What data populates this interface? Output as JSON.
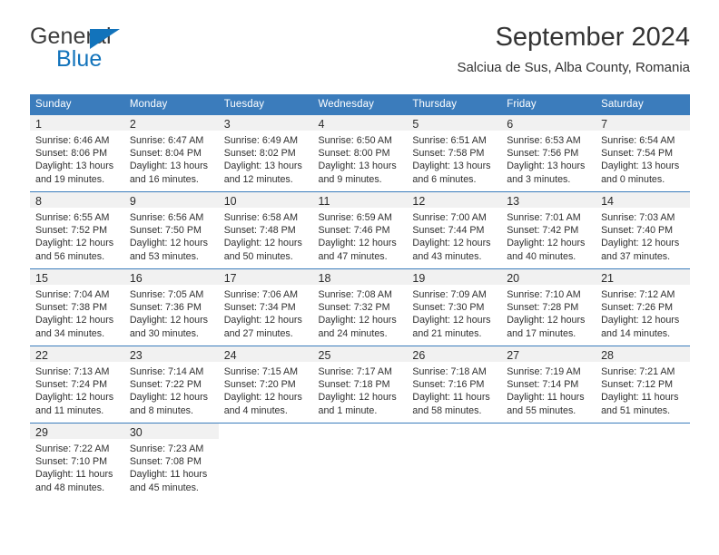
{
  "brand": {
    "name_part1": "General",
    "name_part2": "Blue",
    "logo_icon": "blue-triangle-flag-icon"
  },
  "header": {
    "title": "September 2024",
    "subtitle": "Salciua de Sus, Alba County, Romania"
  },
  "colors": {
    "header_blue": "#3b7cbc",
    "brand_blue": "#1273bb",
    "daynum_bg": "#f1f1f1",
    "text": "#2f2f2f"
  },
  "weekdays": [
    "Sunday",
    "Monday",
    "Tuesday",
    "Wednesday",
    "Thursday",
    "Friday",
    "Saturday"
  ],
  "labels": {
    "sunrise": "Sunrise:",
    "sunset": "Sunset:",
    "daylight": "Daylight:"
  },
  "weeks": [
    [
      {
        "day": "1",
        "sunrise": "Sunrise: 6:46 AM",
        "sunset": "Sunset: 8:06 PM",
        "daylight1": "Daylight: 13 hours",
        "daylight2": "and 19 minutes."
      },
      {
        "day": "2",
        "sunrise": "Sunrise: 6:47 AM",
        "sunset": "Sunset: 8:04 PM",
        "daylight1": "Daylight: 13 hours",
        "daylight2": "and 16 minutes."
      },
      {
        "day": "3",
        "sunrise": "Sunrise: 6:49 AM",
        "sunset": "Sunset: 8:02 PM",
        "daylight1": "Daylight: 13 hours",
        "daylight2": "and 12 minutes."
      },
      {
        "day": "4",
        "sunrise": "Sunrise: 6:50 AM",
        "sunset": "Sunset: 8:00 PM",
        "daylight1": "Daylight: 13 hours",
        "daylight2": "and 9 minutes."
      },
      {
        "day": "5",
        "sunrise": "Sunrise: 6:51 AM",
        "sunset": "Sunset: 7:58 PM",
        "daylight1": "Daylight: 13 hours",
        "daylight2": "and 6 minutes."
      },
      {
        "day": "6",
        "sunrise": "Sunrise: 6:53 AM",
        "sunset": "Sunset: 7:56 PM",
        "daylight1": "Daylight: 13 hours",
        "daylight2": "and 3 minutes."
      },
      {
        "day": "7",
        "sunrise": "Sunrise: 6:54 AM",
        "sunset": "Sunset: 7:54 PM",
        "daylight1": "Daylight: 13 hours",
        "daylight2": "and 0 minutes."
      }
    ],
    [
      {
        "day": "8",
        "sunrise": "Sunrise: 6:55 AM",
        "sunset": "Sunset: 7:52 PM",
        "daylight1": "Daylight: 12 hours",
        "daylight2": "and 56 minutes."
      },
      {
        "day": "9",
        "sunrise": "Sunrise: 6:56 AM",
        "sunset": "Sunset: 7:50 PM",
        "daylight1": "Daylight: 12 hours",
        "daylight2": "and 53 minutes."
      },
      {
        "day": "10",
        "sunrise": "Sunrise: 6:58 AM",
        "sunset": "Sunset: 7:48 PM",
        "daylight1": "Daylight: 12 hours",
        "daylight2": "and 50 minutes."
      },
      {
        "day": "11",
        "sunrise": "Sunrise: 6:59 AM",
        "sunset": "Sunset: 7:46 PM",
        "daylight1": "Daylight: 12 hours",
        "daylight2": "and 47 minutes."
      },
      {
        "day": "12",
        "sunrise": "Sunrise: 7:00 AM",
        "sunset": "Sunset: 7:44 PM",
        "daylight1": "Daylight: 12 hours",
        "daylight2": "and 43 minutes."
      },
      {
        "day": "13",
        "sunrise": "Sunrise: 7:01 AM",
        "sunset": "Sunset: 7:42 PM",
        "daylight1": "Daylight: 12 hours",
        "daylight2": "and 40 minutes."
      },
      {
        "day": "14",
        "sunrise": "Sunrise: 7:03 AM",
        "sunset": "Sunset: 7:40 PM",
        "daylight1": "Daylight: 12 hours",
        "daylight2": "and 37 minutes."
      }
    ],
    [
      {
        "day": "15",
        "sunrise": "Sunrise: 7:04 AM",
        "sunset": "Sunset: 7:38 PM",
        "daylight1": "Daylight: 12 hours",
        "daylight2": "and 34 minutes."
      },
      {
        "day": "16",
        "sunrise": "Sunrise: 7:05 AM",
        "sunset": "Sunset: 7:36 PM",
        "daylight1": "Daylight: 12 hours",
        "daylight2": "and 30 minutes."
      },
      {
        "day": "17",
        "sunrise": "Sunrise: 7:06 AM",
        "sunset": "Sunset: 7:34 PM",
        "daylight1": "Daylight: 12 hours",
        "daylight2": "and 27 minutes."
      },
      {
        "day": "18",
        "sunrise": "Sunrise: 7:08 AM",
        "sunset": "Sunset: 7:32 PM",
        "daylight1": "Daylight: 12 hours",
        "daylight2": "and 24 minutes."
      },
      {
        "day": "19",
        "sunrise": "Sunrise: 7:09 AM",
        "sunset": "Sunset: 7:30 PM",
        "daylight1": "Daylight: 12 hours",
        "daylight2": "and 21 minutes."
      },
      {
        "day": "20",
        "sunrise": "Sunrise: 7:10 AM",
        "sunset": "Sunset: 7:28 PM",
        "daylight1": "Daylight: 12 hours",
        "daylight2": "and 17 minutes."
      },
      {
        "day": "21",
        "sunrise": "Sunrise: 7:12 AM",
        "sunset": "Sunset: 7:26 PM",
        "daylight1": "Daylight: 12 hours",
        "daylight2": "and 14 minutes."
      }
    ],
    [
      {
        "day": "22",
        "sunrise": "Sunrise: 7:13 AM",
        "sunset": "Sunset: 7:24 PM",
        "daylight1": "Daylight: 12 hours",
        "daylight2": "and 11 minutes."
      },
      {
        "day": "23",
        "sunrise": "Sunrise: 7:14 AM",
        "sunset": "Sunset: 7:22 PM",
        "daylight1": "Daylight: 12 hours",
        "daylight2": "and 8 minutes."
      },
      {
        "day": "24",
        "sunrise": "Sunrise: 7:15 AM",
        "sunset": "Sunset: 7:20 PM",
        "daylight1": "Daylight: 12 hours",
        "daylight2": "and 4 minutes."
      },
      {
        "day": "25",
        "sunrise": "Sunrise: 7:17 AM",
        "sunset": "Sunset: 7:18 PM",
        "daylight1": "Daylight: 12 hours",
        "daylight2": "and 1 minute."
      },
      {
        "day": "26",
        "sunrise": "Sunrise: 7:18 AM",
        "sunset": "Sunset: 7:16 PM",
        "daylight1": "Daylight: 11 hours",
        "daylight2": "and 58 minutes."
      },
      {
        "day": "27",
        "sunrise": "Sunrise: 7:19 AM",
        "sunset": "Sunset: 7:14 PM",
        "daylight1": "Daylight: 11 hours",
        "daylight2": "and 55 minutes."
      },
      {
        "day": "28",
        "sunrise": "Sunrise: 7:21 AM",
        "sunset": "Sunset: 7:12 PM",
        "daylight1": "Daylight: 11 hours",
        "daylight2": "and 51 minutes."
      }
    ],
    [
      {
        "day": "29",
        "sunrise": "Sunrise: 7:22 AM",
        "sunset": "Sunset: 7:10 PM",
        "daylight1": "Daylight: 11 hours",
        "daylight2": "and 48 minutes."
      },
      {
        "day": "30",
        "sunrise": "Sunrise: 7:23 AM",
        "sunset": "Sunset: 7:08 PM",
        "daylight1": "Daylight: 11 hours",
        "daylight2": "and 45 minutes."
      },
      {
        "day": "",
        "sunrise": "",
        "sunset": "",
        "daylight1": "",
        "daylight2": ""
      },
      {
        "day": "",
        "sunrise": "",
        "sunset": "",
        "daylight1": "",
        "daylight2": ""
      },
      {
        "day": "",
        "sunrise": "",
        "sunset": "",
        "daylight1": "",
        "daylight2": ""
      },
      {
        "day": "",
        "sunrise": "",
        "sunset": "",
        "daylight1": "",
        "daylight2": ""
      },
      {
        "day": "",
        "sunrise": "",
        "sunset": "",
        "daylight1": "",
        "daylight2": ""
      }
    ]
  ]
}
